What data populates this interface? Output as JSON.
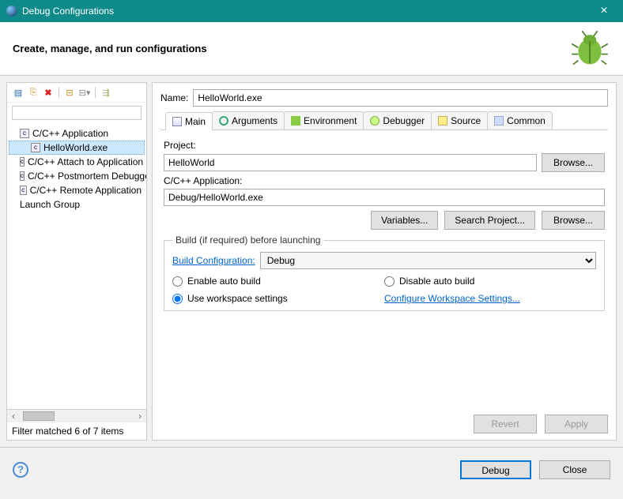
{
  "window": {
    "title": "Debug Configurations",
    "close": "×"
  },
  "header": {
    "text": "Create, manage, and run configurations"
  },
  "toolbar": {
    "new": "📄",
    "dup": "📋",
    "del": "✖",
    "exp": "📁",
    "col": "⇲",
    "fil": "⚙"
  },
  "tree": {
    "items": [
      {
        "label": "C/C++ Application",
        "child": false,
        "sel": false
      },
      {
        "label": "HelloWorld.exe",
        "child": true,
        "sel": true
      },
      {
        "label": "C/C++ Attach to Application",
        "child": false,
        "sel": false
      },
      {
        "label": "C/C++ Postmortem Debugger",
        "child": false,
        "sel": false
      },
      {
        "label": "C/C++ Remote Application",
        "child": false,
        "sel": false
      },
      {
        "label": "Launch Group",
        "child": false,
        "sel": false
      }
    ],
    "filter_status": "Filter matched 6 of 7 items"
  },
  "form": {
    "name_label": "Name:",
    "name_value": "HelloWorld.exe",
    "tabs": [
      "Main",
      "Arguments",
      "Environment",
      "Debugger",
      "Source",
      "Common"
    ],
    "project_label": "Project:",
    "project_value": "HelloWorld",
    "browse": "Browse...",
    "app_label": "C/C++ Application:",
    "app_value": "Debug/HelloWorld.exe",
    "variables": "Variables...",
    "search_project": "Search Project...",
    "build_legend": "Build (if required) before launching",
    "build_config_label": "Build Configuration:",
    "build_config_value": "Debug",
    "enable_auto": "Enable auto build",
    "disable_auto": "Disable auto build",
    "use_workspace": "Use workspace settings",
    "configure_link": "Configure Workspace Settings...",
    "revert": "Revert",
    "apply": "Apply"
  },
  "bottom": {
    "debug": "Debug",
    "close": "Close"
  }
}
